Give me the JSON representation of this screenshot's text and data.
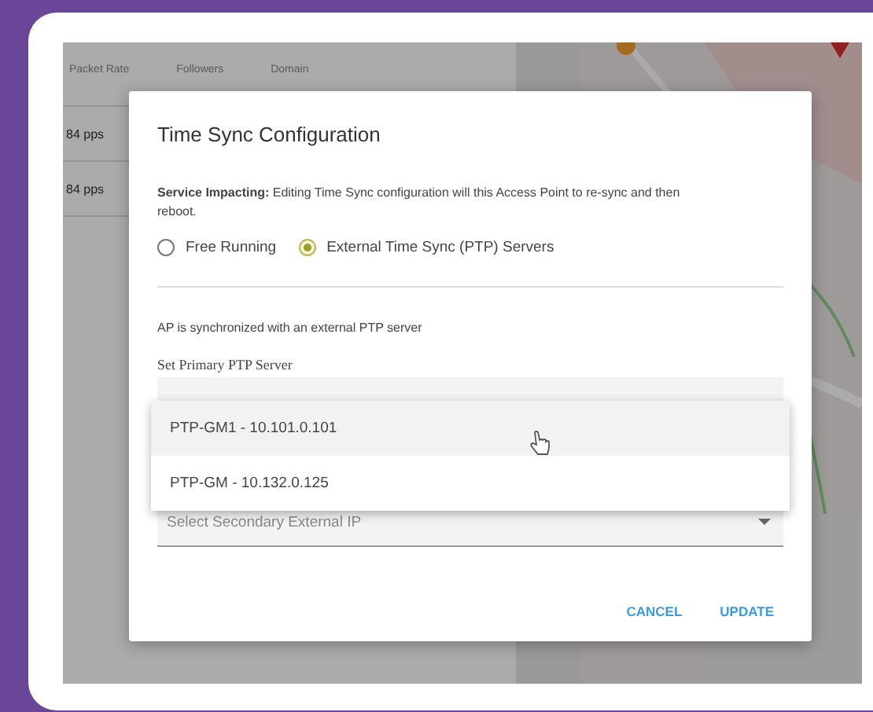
{
  "background_table": {
    "columns": [
      "Packet Rate",
      "Followers",
      "Domain"
    ],
    "rows": [
      [
        "84 pps"
      ],
      [
        "84 pps"
      ]
    ]
  },
  "dialog": {
    "title": "Time Sync Configuration",
    "warning": "**Service Impacting:** Editing Time Sync configuration will this Access Point to re-sync and then reboot.",
    "options": [
      {
        "label": "Free Running",
        "selected": false
      },
      {
        "label": "External Time Sync (PTP) Servers",
        "selected": true
      }
    ],
    "info": "AP is synchronized with an external PTP server",
    "primary_label": "Set Primary PTP Server",
    "secondary_placeholder": "Select Secondary External IP",
    "menu": [
      {
        "label": "PTP-GM1 - 10.101.0.101",
        "highlighted": true
      },
      {
        "label": "PTP-GM - 10.132.0.125",
        "highlighted": false
      }
    ],
    "buttons": [
      "CANCEL",
      "UPDATE"
    ]
  }
}
